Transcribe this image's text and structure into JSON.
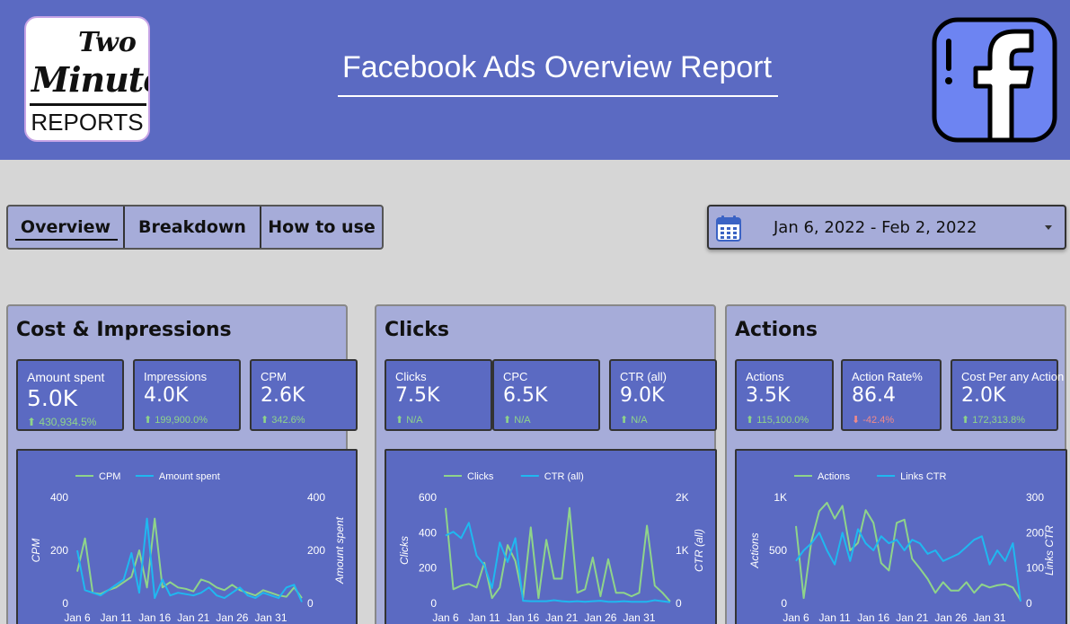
{
  "header": {
    "title": "Facebook Ads Overview Report",
    "logo": {
      "line1": "Two",
      "line2": "Minute",
      "line3": "REPORTS"
    },
    "brand_icon": "facebook-icon",
    "background": "#5b6ac2"
  },
  "tabs": [
    {
      "label": "Overview",
      "active": true
    },
    {
      "label": "Breakdown",
      "active": false
    },
    {
      "label": "How to use",
      "active": false
    }
  ],
  "date_range": {
    "value": "Jan 6, 2022 - Feb 2, 2022",
    "icon": "calendar-icon"
  },
  "panels": [
    {
      "title": "Cost & Impressions",
      "kpis": [
        {
          "label": "Amount spent",
          "value": "5.0K",
          "delta": "⬆ 430,934.5%",
          "trend": "up"
        },
        {
          "label": "Impressions",
          "value": "4.0K",
          "delta": "⬆ 199,900.0%",
          "trend": "up"
        },
        {
          "label": "CPM",
          "value": "2.6K",
          "delta": "⬆ 342.6%",
          "trend": "up"
        }
      ]
    },
    {
      "title": "Clicks",
      "kpis": [
        {
          "label": "Clicks",
          "value": "7.5K",
          "delta": "⬆ N/A",
          "trend": "up"
        },
        {
          "label": "CPC",
          "value": "6.5K",
          "delta": "⬆ N/A",
          "trend": "up"
        },
        {
          "label": "CTR (all)",
          "value": "9.0K",
          "delta": "⬆ N/A",
          "trend": "up"
        }
      ]
    },
    {
      "title": "Actions",
      "kpis": [
        {
          "label": "Actions",
          "value": "3.5K",
          "delta": "⬆ 115,100.0%",
          "trend": "up"
        },
        {
          "label": "Action Rate%",
          "value": "86.4",
          "delta": "⬇ -42.4%",
          "trend": "down"
        },
        {
          "label": "Cost Per any Action",
          "value": "2.0K",
          "delta": "⬆ 172,313.8%",
          "trend": "up"
        }
      ]
    }
  ],
  "chart_data": [
    {
      "type": "line",
      "x_ticks": [
        "Jan 6",
        "Jan 11",
        "Jan 16",
        "Jan 21",
        "Jan 26",
        "Jan 31"
      ],
      "ylabel": "CPM",
      "ylabel_right": "Amount spent",
      "left_ticks": [
        "400",
        "200",
        "0"
      ],
      "right_ticks": [
        "400",
        "200",
        "0"
      ],
      "ylim": [
        0,
        400
      ],
      "ylim_right": [
        0,
        400
      ],
      "legend_position": "top",
      "series": [
        {
          "name": "CPM",
          "axis": "left",
          "color": "#8fd48a",
          "values": [
            120,
            245,
            40,
            35,
            50,
            60,
            80,
            100,
            200,
            60,
            320,
            60,
            80,
            60,
            55,
            45,
            90,
            80,
            60,
            50,
            70,
            50,
            40,
            30,
            50,
            40,
            30,
            25,
            60,
            20
          ]
        },
        {
          "name": "Amount spent",
          "axis": "right",
          "color": "#1fb8f0",
          "values": [
            200,
            50,
            40,
            30,
            50,
            70,
            90,
            190,
            40,
            320,
            20,
            90,
            30,
            40,
            35,
            30,
            40,
            60,
            30,
            20,
            40,
            60,
            30,
            20,
            40,
            30,
            20,
            60,
            70,
            5
          ]
        }
      ]
    },
    {
      "type": "line",
      "x_ticks": [
        "Jan 6",
        "Jan 11",
        "Jan 16",
        "Jan 21",
        "Jan 26",
        "Jan 31"
      ],
      "ylabel": "Clicks",
      "ylabel_right": "CTR (all)",
      "left_ticks": [
        "600",
        "400",
        "200",
        "0"
      ],
      "right_ticks": [
        "2K",
        "1K",
        "0"
      ],
      "ylim": [
        0,
        600
      ],
      "ylim_right": [
        0,
        2000
      ],
      "legend_position": "top",
      "series": [
        {
          "name": "Clicks",
          "axis": "left",
          "color": "#8fd48a",
          "values": [
            540,
            80,
            100,
            110,
            90,
            230,
            30,
            90,
            330,
            240,
            30,
            430,
            30,
            360,
            140,
            140,
            540,
            60,
            80,
            260,
            40,
            250,
            60,
            60,
            40,
            60,
            440,
            100,
            60,
            10
          ]
        },
        {
          "name": "CTR (all)",
          "axis": "right",
          "color": "#1fb8f0",
          "values": [
            1280,
            1350,
            1230,
            1520,
            900,
            720,
            290,
            1150,
            780,
            1230,
            50,
            40,
            40,
            40,
            60,
            40,
            30,
            40,
            30,
            40,
            50,
            30,
            30,
            40,
            30,
            30,
            30,
            60,
            40,
            20
          ]
        }
      ]
    },
    {
      "type": "line",
      "x_ticks": [
        "Jan 6",
        "Jan 11",
        "Jan 16",
        "Jan 21",
        "Jan 26",
        "Jan 31"
      ],
      "ylabel": "Actions",
      "ylabel_right": "Links CTR",
      "left_ticks": [
        "1K",
        "500",
        "0"
      ],
      "right_ticks": [
        "300",
        "200",
        "100",
        "0"
      ],
      "ylim": [
        0,
        1000
      ],
      "ylim_right": [
        0,
        300
      ],
      "legend_position": "top",
      "series": [
        {
          "name": "Actions",
          "axis": "left",
          "color": "#8fd48a",
          "values": [
            730,
            50,
            590,
            870,
            950,
            800,
            920,
            500,
            570,
            880,
            760,
            380,
            310,
            760,
            790,
            420,
            330,
            230,
            100,
            200,
            120,
            120,
            200,
            100,
            180,
            150,
            170,
            180,
            150,
            30
          ]
        },
        {
          "name": "Links CTR",
          "axis": "right",
          "color": "#1fb8f0",
          "values": [
            120,
            150,
            170,
            200,
            150,
            110,
            200,
            120,
            210,
            170,
            150,
            190,
            170,
            180,
            150,
            180,
            170,
            140,
            150,
            120,
            130,
            140,
            160,
            180,
            190,
            110,
            150,
            120,
            170,
            5
          ]
        }
      ]
    }
  ]
}
